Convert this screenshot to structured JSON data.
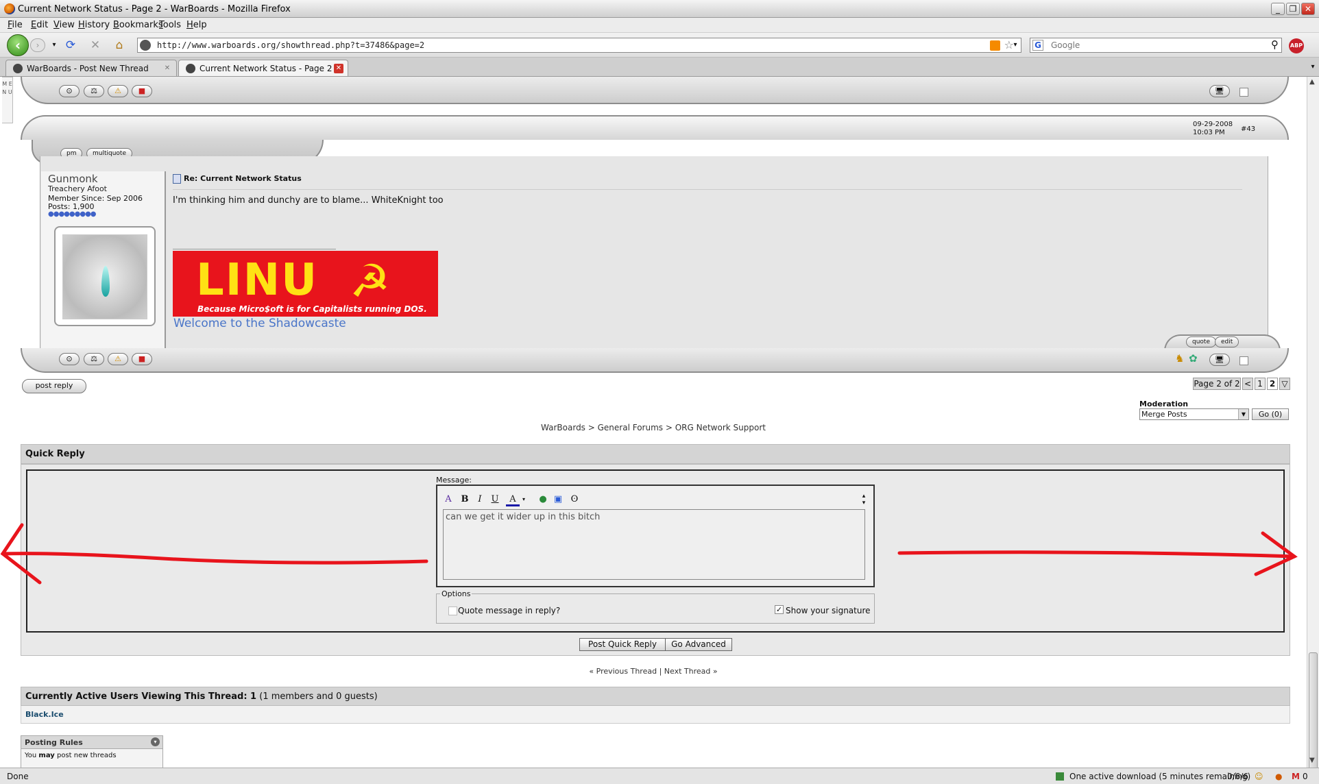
{
  "browser": {
    "title": "Current Network Status - Page 2 - WarBoards - Mozilla Firefox",
    "menu": [
      "File",
      "Edit",
      "View",
      "History",
      "Bookmarks",
      "Tools",
      "Help"
    ],
    "url": "http://www.warboards.org/showthread.php?t=37486&page=2",
    "search_placeholder": "Google",
    "abp": "ABP",
    "tabs": [
      {
        "label": "WarBoards - Post New Thread",
        "active": false
      },
      {
        "label": "Current Network Status - Page 2 ...",
        "active": true
      }
    ],
    "side_menu": "M E N U"
  },
  "post": {
    "date": "09-29-2008",
    "time": "10:03 PM",
    "number": "#43",
    "pm_label": "pm",
    "multiquote_label": "multiquote",
    "username": "Gunmonk",
    "user_title": "Treachery Afoot",
    "member_since": "Member Since: Sep 2006",
    "posts": "Posts: 1,900",
    "title": "Re: Current Network Status",
    "message": "I'm thinking him and dunchy are to blame... WhiteKnight too",
    "banner_big": "LINU",
    "banner_small": "Because Micro$oft is for Capitalists running DOS.",
    "sig_link": "Welcome to the Shadowcaste",
    "quote_label": "quote",
    "edit_label": "edit"
  },
  "thread": {
    "post_reply": "post reply",
    "page_label": "Page 2 of 2",
    "page_prev": "<",
    "page_1": "1",
    "page_2": "2",
    "moderation_label": "Moderation",
    "moderation_value": "Merge Posts",
    "go_label": "Go (0)",
    "breadcrumb": "WarBoards > General Forums > ORG Network Support"
  },
  "quick_reply": {
    "heading": "Quick Reply",
    "message_label": "Message:",
    "message_text": "can we get it wider up in this bitch",
    "options_legend": "Options",
    "quote_option": "Quote message in reply?",
    "signature_option": "Show your signature",
    "post_button": "Post Quick Reply",
    "advanced_button": "Go Advanced"
  },
  "thread_nav": "« Previous Thread | Next Thread »",
  "active_users": {
    "heading": "Currently Active Users Viewing This Thread: 1",
    "heading_suffix": " (1 members and 0 guests)",
    "users": "Black.Ice"
  },
  "posting_rules": {
    "heading": "Posting Rules",
    "line1_pre": "You ",
    "line1_bold": "may",
    "line1_post": " post new threads"
  },
  "status": {
    "left": "Done",
    "download": "One active download (5 minutes remaining)",
    "counter": "0/6/6",
    "mail": "0"
  },
  "colors": {
    "annotation_arrow": "#e8141c",
    "banner_bg": "#e8141c",
    "banner_text": "#ffe114",
    "link": "#4a75c8"
  }
}
